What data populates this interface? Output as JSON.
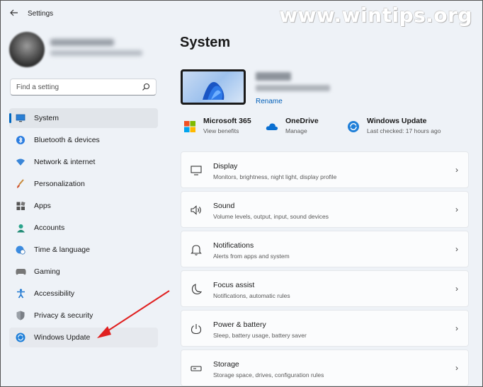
{
  "window": {
    "title": "Settings",
    "back_icon": "back-arrow-icon"
  },
  "watermark": "www.wintips.org",
  "search": {
    "placeholder": "Find a setting"
  },
  "sidebar": {
    "items": [
      {
        "label": "System",
        "icon": "monitor-icon"
      },
      {
        "label": "Bluetooth & devices",
        "icon": "bluetooth-icon"
      },
      {
        "label": "Network & internet",
        "icon": "wifi-icon"
      },
      {
        "label": "Personalization",
        "icon": "brush-icon"
      },
      {
        "label": "Apps",
        "icon": "apps-icon"
      },
      {
        "label": "Accounts",
        "icon": "person-icon"
      },
      {
        "label": "Time & language",
        "icon": "globe-clock-icon"
      },
      {
        "label": "Gaming",
        "icon": "controller-icon"
      },
      {
        "label": "Accessibility",
        "icon": "accessibility-icon"
      },
      {
        "label": "Privacy & security",
        "icon": "shield-icon"
      },
      {
        "label": "Windows Update",
        "icon": "update-icon"
      }
    ],
    "selected": "System"
  },
  "main": {
    "title": "System",
    "device": {
      "rename": "Rename"
    },
    "quick_links": [
      {
        "title": "Microsoft 365",
        "sub": "View benefits",
        "icon": "microsoft-logo-icon"
      },
      {
        "title": "OneDrive",
        "sub": "Manage",
        "icon": "cloud-icon"
      },
      {
        "title": "Windows Update",
        "sub": "Last checked: 17 hours ago",
        "icon": "update-icon"
      }
    ],
    "cards": [
      {
        "title": "Display",
        "sub": "Monitors, brightness, night light, display profile",
        "icon": "display-icon"
      },
      {
        "title": "Sound",
        "sub": "Volume levels, output, input, sound devices",
        "icon": "speaker-icon"
      },
      {
        "title": "Notifications",
        "sub": "Alerts from apps and system",
        "icon": "bell-icon"
      },
      {
        "title": "Focus assist",
        "sub": "Notifications, automatic rules",
        "icon": "moon-icon"
      },
      {
        "title": "Power & battery",
        "sub": "Sleep, battery usage, battery saver",
        "icon": "power-icon"
      },
      {
        "title": "Storage",
        "sub": "Storage space, drives, configuration rules",
        "icon": "storage-icon"
      }
    ]
  },
  "colors": {
    "accent": "#0067c0",
    "annotation_arrow": "#e02020",
    "background": "#eef2f7"
  }
}
